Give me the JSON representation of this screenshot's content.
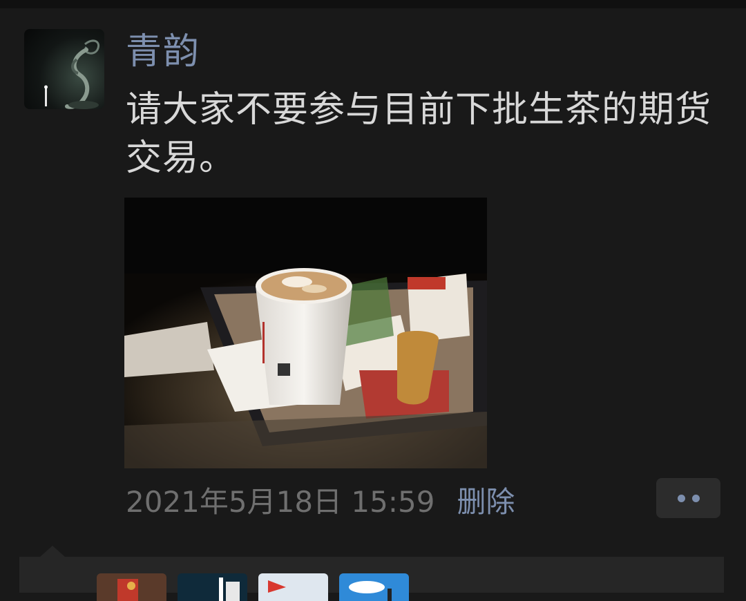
{
  "post": {
    "author": "青韵",
    "text": "请大家不要参与目前下批生茶的期货交易。",
    "timestamp": "2021年5月18日 15:59",
    "delete_label": "删除"
  },
  "icons": {
    "more": "more-dots-icon",
    "comment_caret": "caret-up-icon"
  },
  "colors": {
    "background": "#191919",
    "link": "#7d8fae",
    "text": "#d8d8d8",
    "timestamp": "#6f6f6f",
    "panel": "#262626"
  },
  "likes": {
    "avatars": [
      "like-avatar-1",
      "like-avatar-2",
      "like-avatar-3",
      "like-avatar-4"
    ]
  }
}
